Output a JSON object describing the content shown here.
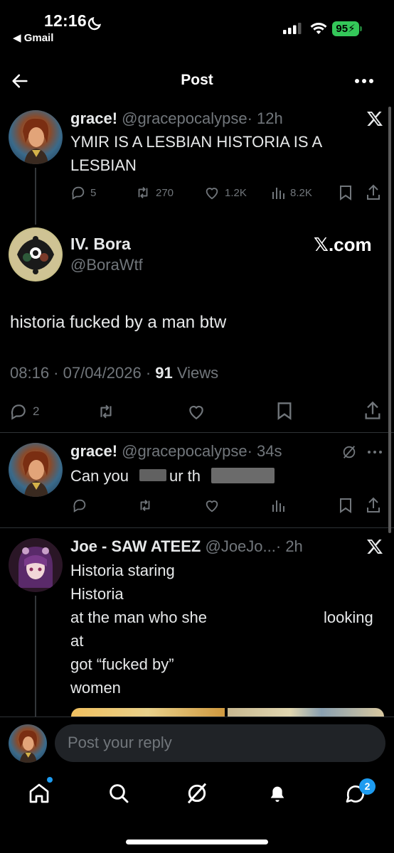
{
  "status": {
    "time": "12:16",
    "back_app": "◀ Gmail",
    "battery": "95"
  },
  "nav": {
    "title": "Post"
  },
  "tweet1": {
    "name": "grace!",
    "handle": "@gracepocalypse",
    "time": "· 12h",
    "text_line1": "YMIR IS A LESBIAN HISTORIA IS A",
    "text_line2": "LESBIAN",
    "replies": "5",
    "retweets": "270",
    "likes": "1.2K",
    "views": "8.2K"
  },
  "main": {
    "name": "IV. Bora",
    "handle": "@BoraWtf",
    "brand": "𝕏.com",
    "text": "historia fucked by a man btw",
    "timestamp": "08:16 · 07/04/2026 · ",
    "views_count": "91",
    "views_label": " Views",
    "replies": "2"
  },
  "reply1": {
    "name": "grace!",
    "handle": "@gracepocalypse",
    "time": "· 34s",
    "text_a": "Can you",
    "text_b": "ur th"
  },
  "reply2": {
    "name": "Joe - SAW ATEEZ",
    "handle": "@JoeJo...",
    "time": "· 2h",
    "line1": "Historia staring",
    "line2": "Historia",
    "line3a": "at the man who she",
    "line3b": "looking",
    "line4": "at",
    "line5": "got “fucked by”",
    "line6": "women"
  },
  "compose": {
    "placeholder": "Post your reply"
  },
  "tabbar": {
    "messages_badge": "2"
  },
  "colors": {
    "accent": "#1d9bf0",
    "battery": "#34c759",
    "bg": "#000000",
    "muted": "#71767b"
  }
}
